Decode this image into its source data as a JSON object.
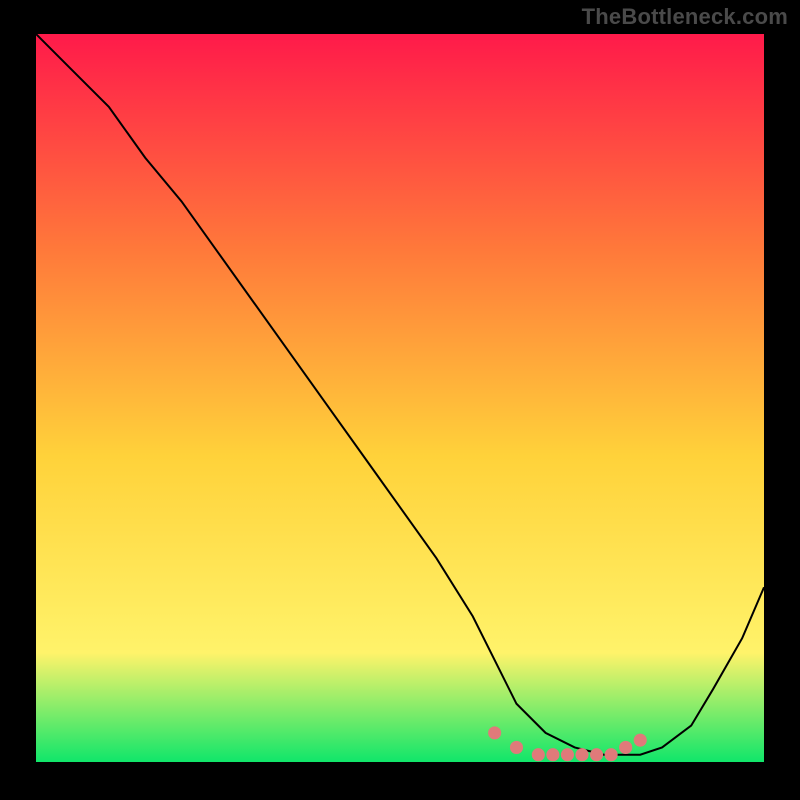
{
  "watermark": "TheBottleneck.com",
  "chart_data": {
    "type": "line",
    "title": "",
    "xlabel": "",
    "ylabel": "",
    "xlim": [
      0,
      100
    ],
    "ylim": [
      0,
      100
    ],
    "grid": false,
    "legend": false,
    "background_gradient": {
      "top": "#ff1a4a",
      "upper_mid": "#ff7a3a",
      "mid": "#ffd23a",
      "lower_mid": "#fff36a",
      "bottom": "#10e66a"
    },
    "series": [
      {
        "name": "curve",
        "stroke": "#000000",
        "x": [
          0,
          5,
          10,
          15,
          20,
          25,
          30,
          35,
          40,
          45,
          50,
          55,
          60,
          63,
          66,
          70,
          74,
          78,
          80,
          83,
          86,
          90,
          93,
          97,
          100
        ],
        "values": [
          100,
          95,
          90,
          83,
          77,
          70,
          63,
          56,
          49,
          42,
          35,
          28,
          20,
          14,
          8,
          4,
          2,
          1,
          1,
          1,
          2,
          5,
          10,
          17,
          24
        ]
      },
      {
        "name": "markers",
        "type": "scatter",
        "marker_color": "#e07a7a",
        "x": [
          63,
          66,
          69,
          71,
          73,
          75,
          77,
          79,
          81,
          83
        ],
        "values": [
          4,
          2,
          1,
          1,
          1,
          1,
          1,
          1,
          2,
          3
        ]
      }
    ]
  }
}
